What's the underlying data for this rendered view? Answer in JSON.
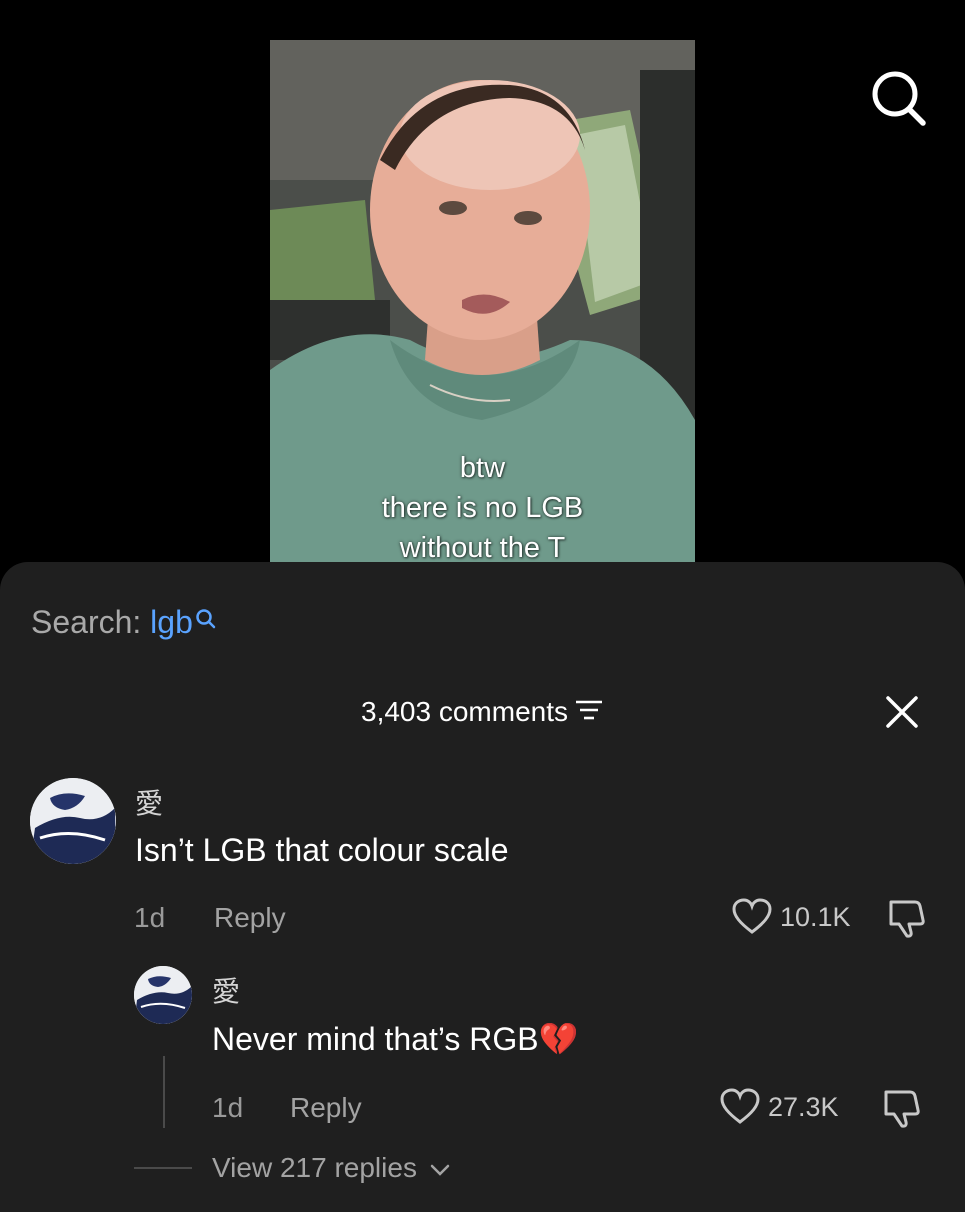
{
  "video": {
    "caption_lines": [
      "btw",
      "there is no LGB",
      "without the T"
    ]
  },
  "top_bar": {
    "search_icon": "search-icon"
  },
  "comments_sheet": {
    "search_label": "Search:",
    "search_term": "lgb",
    "comment_count": "3,403 comments",
    "icons": {
      "filter": "filter-icon",
      "close": "close-icon"
    },
    "comments": [
      {
        "author": "愛",
        "text": "Isn’t LGB that colour scale",
        "age": "1d",
        "reply_label": "Reply",
        "likes": "10.1K"
      }
    ],
    "reply": {
      "author": "愛",
      "text": "Never mind that’s RGB",
      "emoji": "💔",
      "age": "1d",
      "reply_label": "Reply",
      "likes": "27.3K"
    },
    "view_replies": "View 217 replies"
  },
  "colors": {
    "background": "#000000",
    "sheet": "#1f1f1f",
    "accent_blue": "#5aa3ff",
    "muted": "#a3a3a3"
  }
}
